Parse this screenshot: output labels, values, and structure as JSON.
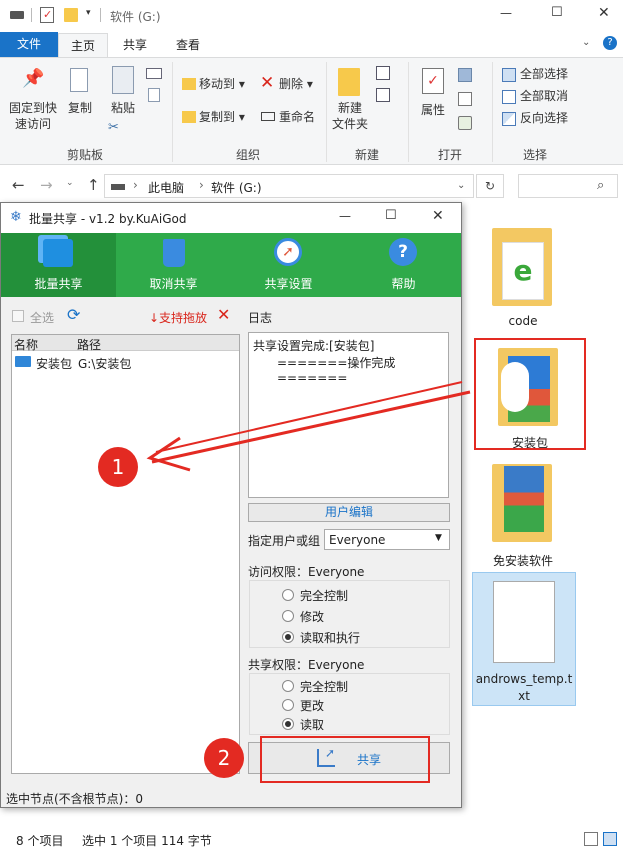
{
  "window": {
    "title": "软件 (G:)",
    "minimize": "—",
    "maximize": "☐",
    "close": "✕"
  },
  "tabs": {
    "file": "文件",
    "home": "主页",
    "share": "共享",
    "view": "查看"
  },
  "ribbon": {
    "clipboard": {
      "pin": "固定到快\n速访问",
      "copy": "复制",
      "paste": "粘贴",
      "label": "剪贴板"
    },
    "organize": {
      "move_to": "移动到 ▾",
      "copy_to": "复制到 ▾",
      "delete": "删除 ▾",
      "rename": "重命名",
      "label": "组织"
    },
    "new": {
      "new_folder": "新建\n文件夹",
      "label": "新建"
    },
    "open": {
      "properties": "属性",
      "label": "打开"
    },
    "select": {
      "select_all": "全部选择",
      "select_none": "全部取消",
      "invert": "反向选择",
      "label": "选择"
    }
  },
  "address": {
    "crumbs": [
      "此电脑",
      "软件 (G:)"
    ],
    "sep": "›"
  },
  "files": [
    {
      "name": "code"
    },
    {
      "name": "安装包"
    },
    {
      "name": "免安装软件"
    },
    {
      "name": "androws_temp.t\nxt"
    }
  ],
  "status": {
    "count": "8 个项目",
    "selection": "选中 1 个项目  114 字节"
  },
  "dialog": {
    "title": "批量共享 - v1.2 by.KuAiGod",
    "tools": [
      "批量共享",
      "取消共享",
      "共享设置",
      "帮助"
    ],
    "select_all": "全选",
    "drag_support": "↓支持拖放",
    "cols": {
      "name": "名称",
      "path": "路径"
    },
    "rows": [
      {
        "name": "安装包",
        "path": "G:\\安装包"
      }
    ],
    "log_label": "日志",
    "log_lines": [
      "共享设置完成:[安装包]",
      "=======操作完成======="
    ],
    "user_edit": "用户编辑",
    "user_label": "指定用户或组",
    "user_value": "Everyone",
    "access_title": "访问权限：Everyone",
    "access_options": [
      "完全控制",
      "修改",
      "读取和执行"
    ],
    "access_selected": 2,
    "share_title": "共享权限：Everyone",
    "share_options": [
      "完全控制",
      "更改",
      "读取"
    ],
    "share_selected": 2,
    "share_button": "共享",
    "footer": "选中节点(不含根节点)：0"
  },
  "annotations": {
    "step1": "1",
    "step2": "2"
  },
  "colors": {
    "accent": "#1a73c8",
    "toolbar_green": "#2faa4a",
    "annotation_red": "#e32a22"
  }
}
